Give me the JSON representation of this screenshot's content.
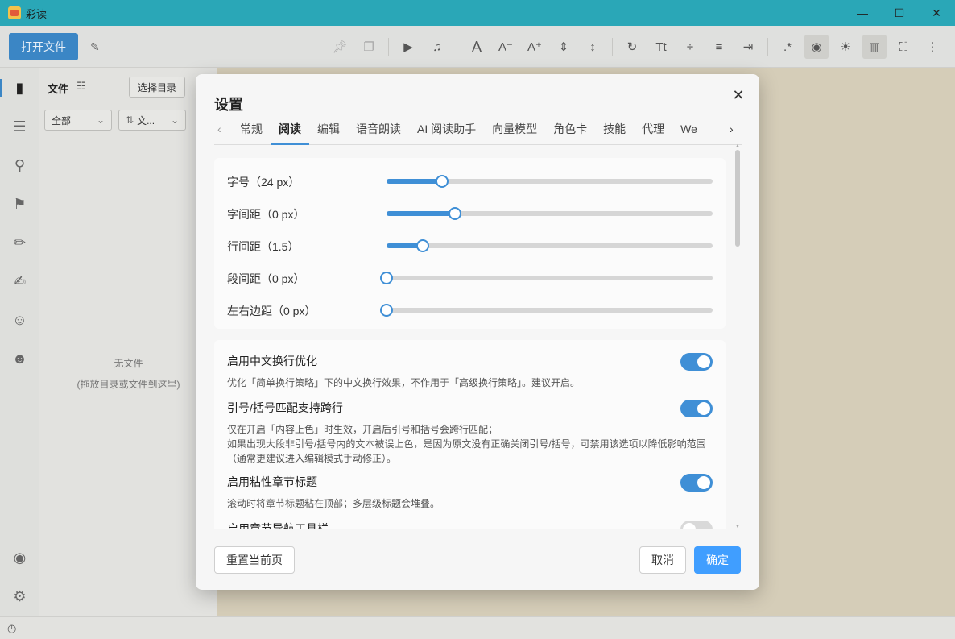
{
  "window": {
    "title": "彩读",
    "min": "—",
    "max": "☐",
    "close": "✕"
  },
  "toolbar": {
    "open_file": "打开文件"
  },
  "file_panel": {
    "title": "文件",
    "select_dir": "选择目录",
    "filter_all": "全部",
    "filter_sort": "文...",
    "empty_title": "无文件",
    "empty_hint": "(拖放目录或文件到这里)"
  },
  "dialog": {
    "title": "设置",
    "tabs": [
      {
        "label": "常规",
        "active": false
      },
      {
        "label": "阅读",
        "active": true
      },
      {
        "label": "编辑",
        "active": false
      },
      {
        "label": "语音朗读",
        "active": false
      },
      {
        "label": "AI 阅读助手",
        "active": false
      },
      {
        "label": "向量模型",
        "active": false
      },
      {
        "label": "角色卡",
        "active": false
      },
      {
        "label": "技能",
        "active": false
      },
      {
        "label": "代理",
        "active": false
      },
      {
        "label": "We",
        "active": false
      }
    ],
    "sliders": [
      {
        "label": "字号（24 px）",
        "value": 0.17
      },
      {
        "label": "字间距（0 px）",
        "value": 0.21
      },
      {
        "label": "行间距（1.5）",
        "value": 0.11
      },
      {
        "label": "段间距（0 px）",
        "value": 0.0
      },
      {
        "label": "左右边距（0 px）",
        "value": 0.0
      }
    ],
    "toggles": [
      {
        "title": "启用中文换行优化",
        "desc": [
          "优化「简单换行策略」下的中文换行效果，不作用于「高级换行策略」。建议开启。"
        ],
        "on": true
      },
      {
        "title": "引号/括号匹配支持跨行",
        "desc": [
          "仅在开启「内容上色」时生效，开启后引号和括号会跨行匹配；",
          "如果出现大段非引号/括号内的文本被误上色，是因为原文没有正确关闭引号/括号，可禁用该选项以降低影响范围",
          "（通常更建议进入编辑模式手动修正）。"
        ],
        "on": true
      },
      {
        "title": "启用粘性章节标题",
        "desc": [
          "滚动时将章节标题粘在顶部；多层级标题会堆叠。"
        ],
        "on": true
      },
      {
        "title": "启用章节导航工具栏",
        "desc": [],
        "on": false
      }
    ],
    "reset": "重置当前页",
    "cancel": "取消",
    "ok": "确定"
  },
  "colors": {
    "accent": "#3f8fd6",
    "titlebar": "#2aa7b7",
    "reader_bg": "#d5cdb8"
  }
}
